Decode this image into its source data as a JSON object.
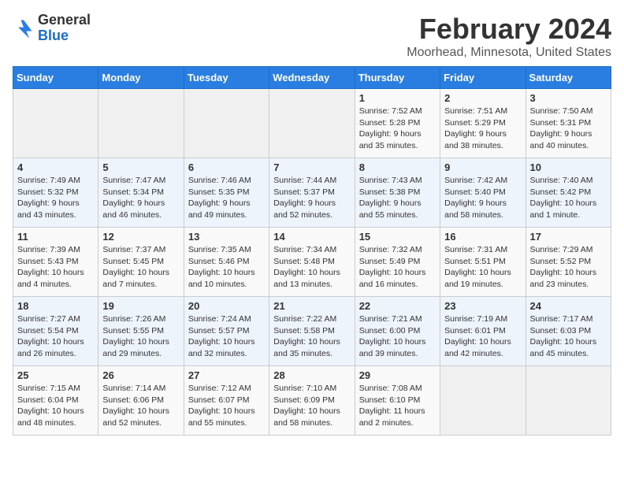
{
  "logo": {
    "general": "General",
    "blue": "Blue"
  },
  "title": "February 2024",
  "location": "Moorhead, Minnesota, United States",
  "days_of_week": [
    "Sunday",
    "Monday",
    "Tuesday",
    "Wednesday",
    "Thursday",
    "Friday",
    "Saturday"
  ],
  "weeks": [
    [
      {
        "day": "",
        "info": ""
      },
      {
        "day": "",
        "info": ""
      },
      {
        "day": "",
        "info": ""
      },
      {
        "day": "",
        "info": ""
      },
      {
        "day": "1",
        "info": "Sunrise: 7:52 AM\nSunset: 5:28 PM\nDaylight: 9 hours\nand 35 minutes."
      },
      {
        "day": "2",
        "info": "Sunrise: 7:51 AM\nSunset: 5:29 PM\nDaylight: 9 hours\nand 38 minutes."
      },
      {
        "day": "3",
        "info": "Sunrise: 7:50 AM\nSunset: 5:31 PM\nDaylight: 9 hours\nand 40 minutes."
      }
    ],
    [
      {
        "day": "4",
        "info": "Sunrise: 7:49 AM\nSunset: 5:32 PM\nDaylight: 9 hours\nand 43 minutes."
      },
      {
        "day": "5",
        "info": "Sunrise: 7:47 AM\nSunset: 5:34 PM\nDaylight: 9 hours\nand 46 minutes."
      },
      {
        "day": "6",
        "info": "Sunrise: 7:46 AM\nSunset: 5:35 PM\nDaylight: 9 hours\nand 49 minutes."
      },
      {
        "day": "7",
        "info": "Sunrise: 7:44 AM\nSunset: 5:37 PM\nDaylight: 9 hours\nand 52 minutes."
      },
      {
        "day": "8",
        "info": "Sunrise: 7:43 AM\nSunset: 5:38 PM\nDaylight: 9 hours\nand 55 minutes."
      },
      {
        "day": "9",
        "info": "Sunrise: 7:42 AM\nSunset: 5:40 PM\nDaylight: 9 hours\nand 58 minutes."
      },
      {
        "day": "10",
        "info": "Sunrise: 7:40 AM\nSunset: 5:42 PM\nDaylight: 10 hours\nand 1 minute."
      }
    ],
    [
      {
        "day": "11",
        "info": "Sunrise: 7:39 AM\nSunset: 5:43 PM\nDaylight: 10 hours\nand 4 minutes."
      },
      {
        "day": "12",
        "info": "Sunrise: 7:37 AM\nSunset: 5:45 PM\nDaylight: 10 hours\nand 7 minutes."
      },
      {
        "day": "13",
        "info": "Sunrise: 7:35 AM\nSunset: 5:46 PM\nDaylight: 10 hours\nand 10 minutes."
      },
      {
        "day": "14",
        "info": "Sunrise: 7:34 AM\nSunset: 5:48 PM\nDaylight: 10 hours\nand 13 minutes."
      },
      {
        "day": "15",
        "info": "Sunrise: 7:32 AM\nSunset: 5:49 PM\nDaylight: 10 hours\nand 16 minutes."
      },
      {
        "day": "16",
        "info": "Sunrise: 7:31 AM\nSunset: 5:51 PM\nDaylight: 10 hours\nand 19 minutes."
      },
      {
        "day": "17",
        "info": "Sunrise: 7:29 AM\nSunset: 5:52 PM\nDaylight: 10 hours\nand 23 minutes."
      }
    ],
    [
      {
        "day": "18",
        "info": "Sunrise: 7:27 AM\nSunset: 5:54 PM\nDaylight: 10 hours\nand 26 minutes."
      },
      {
        "day": "19",
        "info": "Sunrise: 7:26 AM\nSunset: 5:55 PM\nDaylight: 10 hours\nand 29 minutes."
      },
      {
        "day": "20",
        "info": "Sunrise: 7:24 AM\nSunset: 5:57 PM\nDaylight: 10 hours\nand 32 minutes."
      },
      {
        "day": "21",
        "info": "Sunrise: 7:22 AM\nSunset: 5:58 PM\nDaylight: 10 hours\nand 35 minutes."
      },
      {
        "day": "22",
        "info": "Sunrise: 7:21 AM\nSunset: 6:00 PM\nDaylight: 10 hours\nand 39 minutes."
      },
      {
        "day": "23",
        "info": "Sunrise: 7:19 AM\nSunset: 6:01 PM\nDaylight: 10 hours\nand 42 minutes."
      },
      {
        "day": "24",
        "info": "Sunrise: 7:17 AM\nSunset: 6:03 PM\nDaylight: 10 hours\nand 45 minutes."
      }
    ],
    [
      {
        "day": "25",
        "info": "Sunrise: 7:15 AM\nSunset: 6:04 PM\nDaylight: 10 hours\nand 48 minutes."
      },
      {
        "day": "26",
        "info": "Sunrise: 7:14 AM\nSunset: 6:06 PM\nDaylight: 10 hours\nand 52 minutes."
      },
      {
        "day": "27",
        "info": "Sunrise: 7:12 AM\nSunset: 6:07 PM\nDaylight: 10 hours\nand 55 minutes."
      },
      {
        "day": "28",
        "info": "Sunrise: 7:10 AM\nSunset: 6:09 PM\nDaylight: 10 hours\nand 58 minutes."
      },
      {
        "day": "29",
        "info": "Sunrise: 7:08 AM\nSunset: 6:10 PM\nDaylight: 11 hours\nand 2 minutes."
      },
      {
        "day": "",
        "info": ""
      },
      {
        "day": "",
        "info": ""
      }
    ]
  ]
}
